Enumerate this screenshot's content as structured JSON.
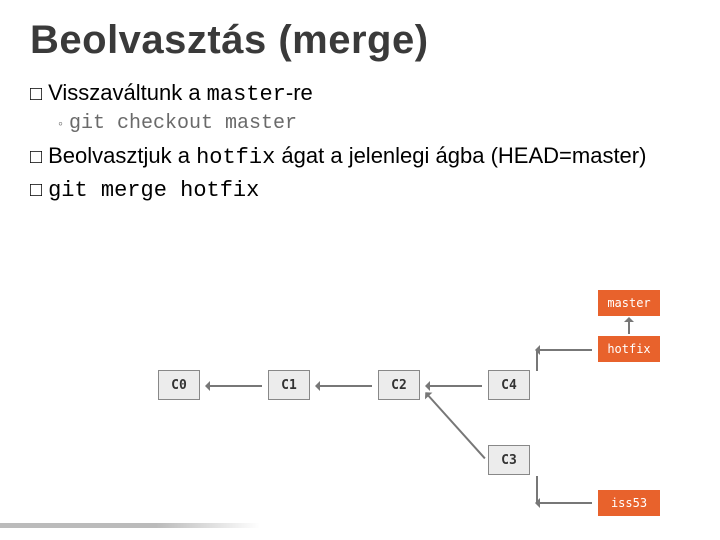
{
  "title": "Beolvasztás (merge)",
  "bullets": {
    "b1_word": "Visszaváltunk",
    "b1_rest": " a ",
    "b1_code": "master",
    "b1_suffix": "-re",
    "sub1_cmd": "git checkout master",
    "b2_word": "Beolvasztjuk",
    "b2_mid": " a ",
    "b2_code": "hotfix",
    "b2_rest": " ágat a jelenlegi ágba (HEAD=master)",
    "b3_code": "git merge hotfix"
  },
  "commits": {
    "c0": "C0",
    "c1": "C1",
    "c2": "C2",
    "c3": "C3",
    "c4": "C4"
  },
  "branches": {
    "master": "master",
    "hotfix": "hotfix",
    "iss53": "iss53"
  }
}
